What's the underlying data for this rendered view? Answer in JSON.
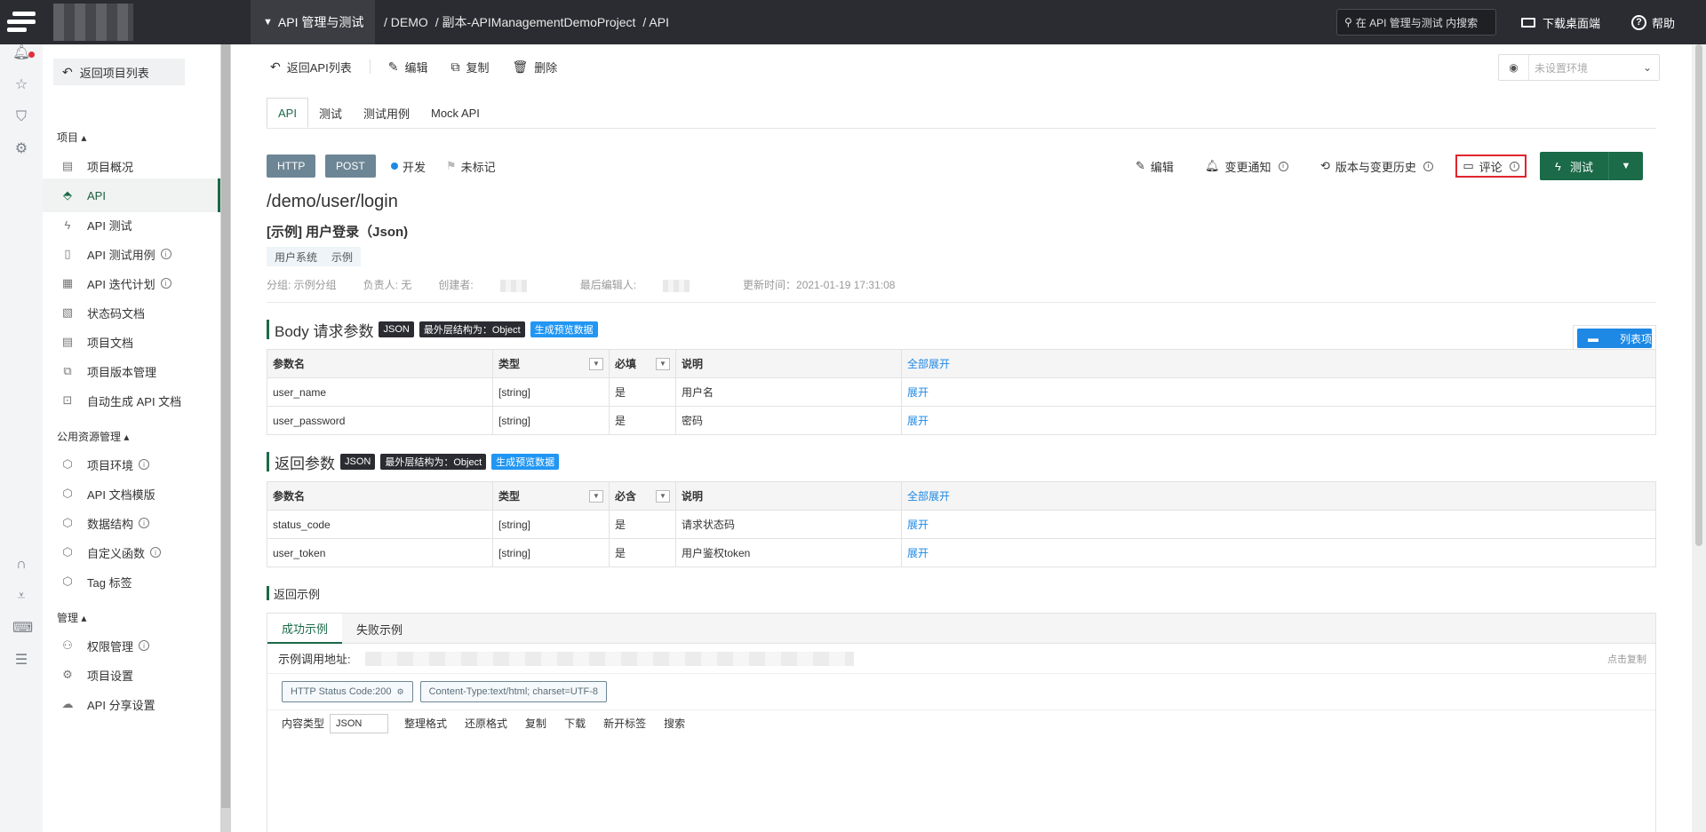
{
  "topbar": {
    "module": "API 管理与测试",
    "breadcrumb": [
      "/ DEMO",
      "/ 副本-APIManagementDemoProject",
      "/ API"
    ],
    "search_placeholder": "在 API 管理与测试 内搜索",
    "download_label": "下载桌面端",
    "help_label": "帮助"
  },
  "sidebar": {
    "back_label": "返回项目列表",
    "group_project": "项目",
    "project_items": [
      {
        "label": "项目概况",
        "icon": "doc-icon"
      },
      {
        "label": "API",
        "icon": "plug-icon"
      },
      {
        "label": "API 测试",
        "icon": "bolt-icon"
      },
      {
        "label": "API 测试用例",
        "icon": "clipboard-icon"
      },
      {
        "label": "API 迭代计划",
        "icon": "calendar-icon"
      },
      {
        "label": "状态码文档",
        "icon": "file-icon"
      },
      {
        "label": "项目文档",
        "icon": "doc-icon"
      },
      {
        "label": "项目版本管理",
        "icon": "copy-icon"
      },
      {
        "label": "自动生成 API 文档",
        "icon": "robot-icon"
      }
    ],
    "group_public": "公用资源管理",
    "public_items": [
      {
        "label": "项目环境"
      },
      {
        "label": "API 文档模版"
      },
      {
        "label": "数据结构"
      },
      {
        "label": "自定义函数"
      },
      {
        "label": "Tag 标签"
      }
    ],
    "group_manage": "管理",
    "manage_items": [
      {
        "label": "权限管理"
      },
      {
        "label": "项目设置"
      },
      {
        "label": "API 分享设置"
      }
    ]
  },
  "toolbar": {
    "back": "返回API列表",
    "edit": "编辑",
    "copy": "复制",
    "delete": "删除",
    "env_placeholder": "未设置环境"
  },
  "tabs": [
    "API",
    "测试",
    "测试用例",
    "Mock API"
  ],
  "api": {
    "protocol": "HTTP",
    "method": "POST",
    "status": "开发",
    "mark": "未标记",
    "path": "/demo/user/login",
    "name": "[示例] 用户登录（Json)",
    "tags": [
      "用户系统",
      "示例"
    ],
    "meta": {
      "group": "分组: 示例分组",
      "owner": "负责人: 无",
      "creator": "创建者:",
      "editor": "最后编辑人:",
      "updated": "更新时间：2021-01-19 17:31:08"
    }
  },
  "actions": {
    "edit": "编辑",
    "notify": "变更通知",
    "history": "版本与变更历史",
    "comment": "评论",
    "test": "测试"
  },
  "body_params": {
    "title": "Body 请求参数",
    "badge_format": "JSON",
    "badge_structure": "最外层结构为：Object",
    "badge_preview": "生成预览数据",
    "list_btn": "列表项",
    "headers": [
      "参数名",
      "类型",
      "必填",
      "说明",
      "全部展开"
    ],
    "rows": [
      {
        "name": "user_name",
        "type": "[string]",
        "required": "是",
        "desc": "用户名",
        "action": "展开"
      },
      {
        "name": "user_password",
        "type": "[string]",
        "required": "是",
        "desc": "密码",
        "action": "展开"
      }
    ]
  },
  "return_params": {
    "title": "返回参数",
    "badge_format": "JSON",
    "badge_structure": "最外层结构为：Object",
    "badge_preview": "生成预览数据",
    "headers": [
      "参数名",
      "类型",
      "必含",
      "说明",
      "全部展开"
    ],
    "rows": [
      {
        "name": "status_code",
        "type": "[string]",
        "required": "是",
        "desc": "请求状态码",
        "action": "展开"
      },
      {
        "name": "user_token",
        "type": "[string]",
        "required": "是",
        "desc": "用户鉴权token",
        "action": "展开"
      }
    ]
  },
  "example": {
    "title": "返回示例",
    "tabs": [
      "成功示例",
      "失败示例"
    ],
    "url_label": "示例调用地址:",
    "copy_label": "点击复制",
    "status_chip": "HTTP Status Code:200",
    "content_type_chip": "Content-Type:text/html; charset=UTF-8",
    "content_type_label": "内容类型",
    "content_type_value": "JSON",
    "ops": [
      "整理格式",
      "还原格式",
      "复制",
      "下载",
      "新开标签",
      "搜索"
    ]
  }
}
